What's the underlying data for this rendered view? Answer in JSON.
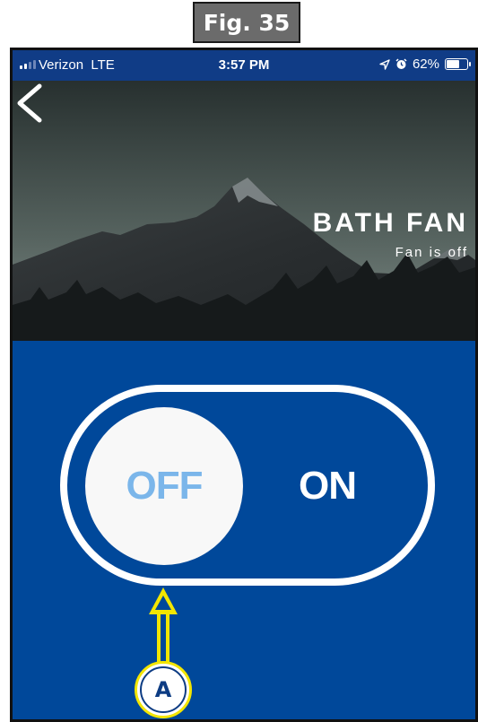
{
  "figure": {
    "label": "Fig. 35"
  },
  "status_bar": {
    "carrier": "Verizon",
    "network": "LTE",
    "time": "3:57 PM",
    "battery": "62%",
    "icons": [
      "signal-icon",
      "location-arrow-icon",
      "alarm-icon",
      "battery-icon"
    ]
  },
  "header": {
    "back_icon": "chevron-left-icon",
    "title": "BATH FAN",
    "subtitle": "Fan is off"
  },
  "toggle": {
    "off_label": "OFF",
    "on_label": "ON",
    "state": "off"
  },
  "callout": {
    "label": "A"
  },
  "colors": {
    "background": "#00489a",
    "status_bar": "#103c86",
    "off_text": "#7bb6ea",
    "callout_outline": "#f3e600",
    "callout_text": "#0d3c83"
  }
}
